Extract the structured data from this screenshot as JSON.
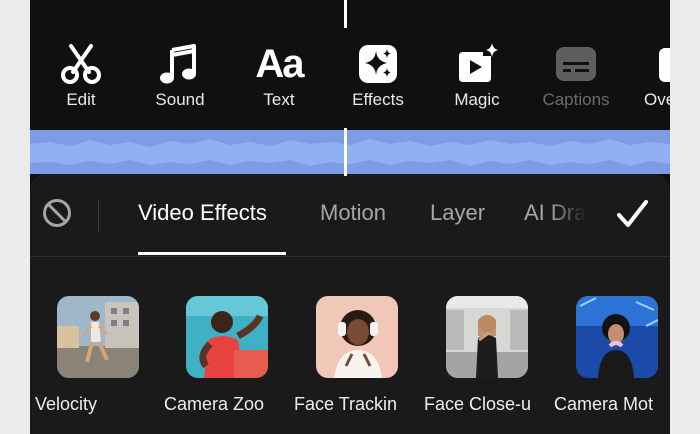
{
  "toolbar": {
    "items": [
      {
        "label": "Edit",
        "icon": "scissors-icon"
      },
      {
        "label": "Sound",
        "icon": "music-note-icon"
      },
      {
        "label": "Text",
        "icon": "text-aa-icon",
        "glyph": "Aa"
      },
      {
        "label": "Effects",
        "icon": "sparkles-icon"
      },
      {
        "label": "Magic",
        "icon": "magic-video-icon"
      },
      {
        "label": "Captions",
        "icon": "captions-icon",
        "disabled": true
      },
      {
        "label": "Ove",
        "icon": "overlay-icon"
      }
    ]
  },
  "panel": {
    "tabs": [
      {
        "label": "Video Effects",
        "active": true
      },
      {
        "label": "Motion"
      },
      {
        "label": "Layer"
      },
      {
        "label": "AI Dra"
      }
    ],
    "effects": [
      {
        "label": "Velocity"
      },
      {
        "label": "Camera Zoo"
      },
      {
        "label": "Face Trackin"
      },
      {
        "label": "Face Close-u"
      },
      {
        "label": "Camera Mot"
      }
    ]
  },
  "colors": {
    "background": "#101010",
    "panel": "#1a1a1a",
    "waveform": "#7c9de6",
    "text": "#ffffff",
    "muted": "#a6a6a6",
    "disabled": "#6b6b6b"
  }
}
